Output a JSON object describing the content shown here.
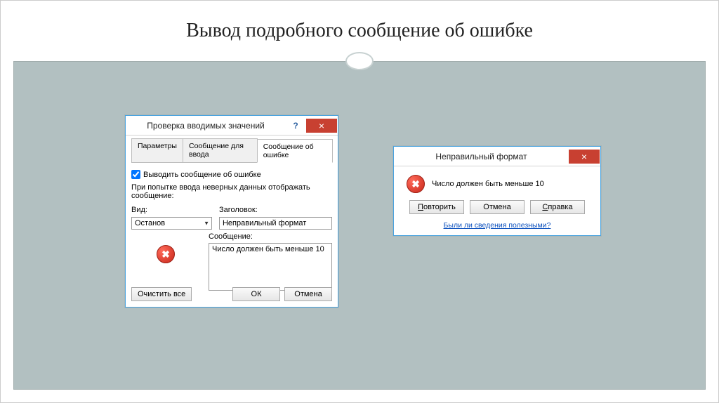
{
  "slide": {
    "title": "Вывод подробного сообщение об ошибке"
  },
  "dialog1": {
    "title": "Проверка вводимых значений",
    "help_symbol": "?",
    "close_symbol": "×",
    "tabs": {
      "t1": "Параметры",
      "t2": "Сообщение для ввода",
      "t3": "Сообщение об ошибке"
    },
    "checkbox_label": "Выводить сообщение об ошибке",
    "instruction": "При попытке ввода неверных данных отображать сообщение:",
    "labels": {
      "type": "Вид:",
      "header": "Заголовок:",
      "message": "Сообщение:"
    },
    "values": {
      "type": "Останов",
      "header": "Неправильный формат",
      "message": "Число должен быть меньше 10"
    },
    "buttons": {
      "clear": "Очистить все",
      "ok": "ОК",
      "cancel": "Отмена"
    }
  },
  "dialog2": {
    "title": "Неправильный формат",
    "close_symbol": "×",
    "message": "Число должен быть меньше 10",
    "buttons": {
      "retry": "Повторить",
      "retry_u": "П",
      "cancel": "Отмена",
      "help": "Справка",
      "help_u": "С"
    },
    "help_link": "Были ли сведения полезными?"
  }
}
